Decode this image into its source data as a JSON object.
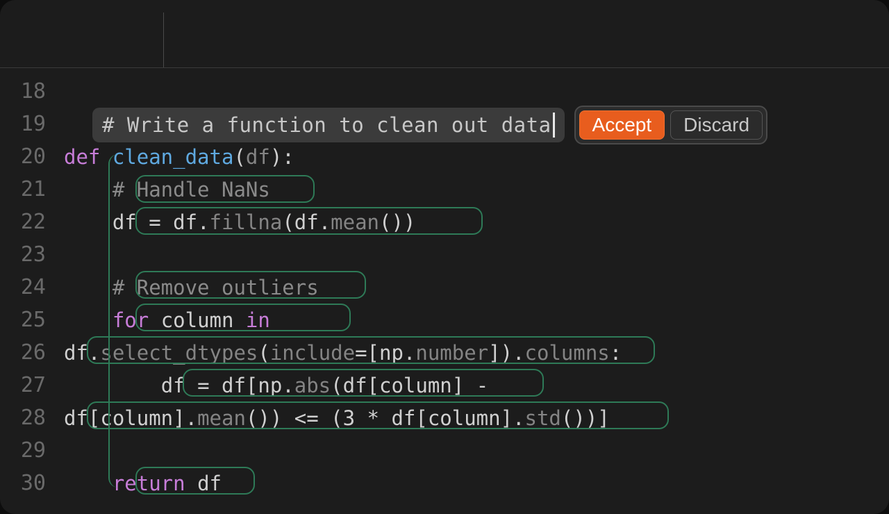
{
  "prompt": {
    "text": "# Write a function to clean out data",
    "accept_label": "Accept",
    "discard_label": "Discard"
  },
  "gutter": {
    "l18": "18",
    "l19": "19",
    "l20": "20",
    "l21": "21",
    "l22": "22",
    "l23": "23",
    "l24": "24",
    "l25": "25",
    "l26": "26",
    "l27": "27",
    "l28": "28",
    "l29": "29",
    "l30": "30"
  },
  "code": {
    "l20_def": "def ",
    "l20_name": "clean_data",
    "l20_open": "(",
    "l20_param": "df",
    "l20_close": "):",
    "l21_indent": "    ",
    "l21_comment": "# Handle NaNs",
    "l22_indent": "    ",
    "l22_lhs": "df ",
    "l22_eq": "= ",
    "l22_rhs1": "df.",
    "l22_fillna": "fillna",
    "l22_open": "(",
    "l22_rhs2": "df.",
    "l22_mean": "mean",
    "l22_close": "())",
    "l24_indent": "    ",
    "l24_comment": "# Remove outliers",
    "l25_indent": "    ",
    "l25_for": "for ",
    "l25_col": "column ",
    "l25_in": "in",
    "l26_df": "df.",
    "l26_sel": "select_dtypes",
    "l26_open": "(",
    "l26_inc": "include",
    "l26_eq": "=",
    "l26_br1": "[np.",
    "l26_num": "number",
    "l26_br2": "]).",
    "l26_cols": "columns",
    "l26_colon": ":",
    "l27_indent": "        ",
    "l27_lhs": "df ",
    "l27_eq": "= ",
    "l27_rhs1": "df[np.",
    "l27_abs": "abs",
    "l27_open": "(",
    "l27_rhs2": "df[column] ",
    "l27_minus": "-",
    "l28_df": "df[column].",
    "l28_mean": "mean",
    "l28_mid": "()) <= (",
    "l28_three": "3",
    "l28_star": " * ",
    "l28_df2": "df[column].",
    "l28_std": "std",
    "l28_close": "())]",
    "l30_indent": "    ",
    "l30_return": "return ",
    "l30_df": "df"
  },
  "colors": {
    "accent": "#e85d1e",
    "suggestion_border": "#2e7a57",
    "background": "#1c1c1c"
  }
}
